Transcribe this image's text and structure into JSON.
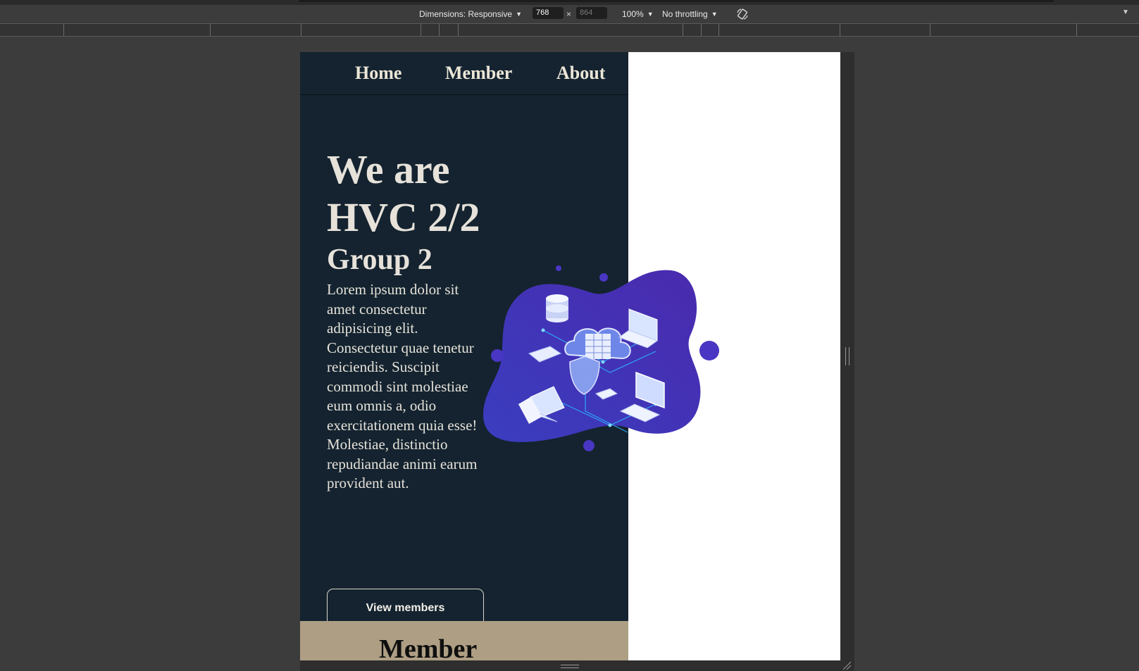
{
  "devtools": {
    "dimensions_label": "Dimensions: Responsive",
    "width_value": "768",
    "times_sign": "×",
    "height_placeholder": "864",
    "zoom_label": "100%",
    "throttling_label": "No throttling",
    "rotate_icon": "rotate-icon",
    "more_icon": "chevron-down-icon"
  },
  "nav": {
    "links": [
      "Home",
      "Member",
      "About"
    ]
  },
  "hero": {
    "title_line1": "We are",
    "title_line2": "HVC 2/2",
    "subtitle": "Group 2",
    "text": "Lorem ipsum dolor sit amet consectetur adipisicing elit. Consectetur quae tenetur reiciendis. Suscipit commodi sint molestiae eum omnis a, odio exercitationem quia esse! Molestiae, distinctio repudiandae animi earum provident aut.",
    "button_label": "View members",
    "illustration": "cloud-network-illustration"
  },
  "member_section": {
    "heading": "Member"
  },
  "colors": {
    "nav_bg": "#14232f",
    "hero_bg": "#14232f",
    "member_bg": "#ae9f84",
    "blob": "#4a35b8",
    "text_light": "#e6e2da"
  }
}
